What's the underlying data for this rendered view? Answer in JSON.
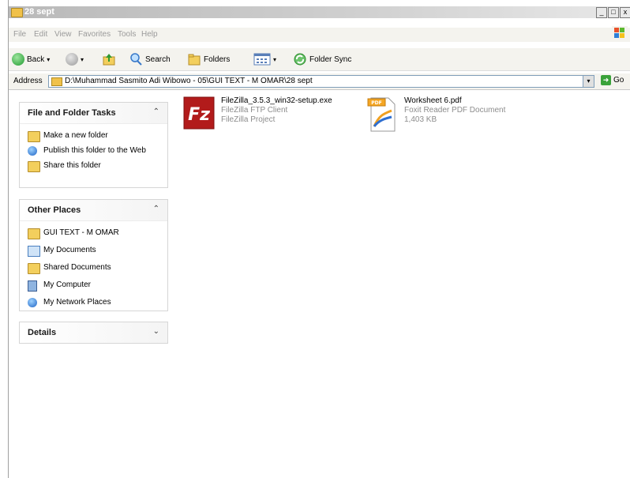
{
  "window": {
    "title": "28 sept",
    "buttons": {
      "minimize": "_",
      "maximize": "□",
      "close": "x"
    }
  },
  "menu": [
    "File",
    "Edit",
    "View",
    "Favorites",
    "Tools",
    "Help"
  ],
  "toolbar": {
    "back": "Back",
    "search": "Search",
    "folders": "Folders",
    "folder_sync": "Folder Sync"
  },
  "address": {
    "label": "Address",
    "path": "D:\\Muhammad Sasmito Adi Wibowo - 05\\GUI TEXT - M OMAR\\28 sept",
    "go": "Go"
  },
  "sidebar": {
    "tasks": {
      "title": "File and Folder Tasks",
      "items": [
        "Make a new folder",
        "Publish this folder to the Web",
        "Share this folder"
      ]
    },
    "other_places": {
      "title": "Other Places",
      "items": [
        "GUI TEXT - M OMAR",
        "My Documents",
        "Shared Documents",
        "My Computer",
        "My Network Places"
      ]
    },
    "details": {
      "title": "Details"
    }
  },
  "files": [
    {
      "name": "FileZilla_3.5.3_win32-setup.exe",
      "type": "FileZilla FTP Client",
      "company": "FileZilla Project",
      "icon": "filezilla-icon"
    },
    {
      "name": "Worksheet 6.pdf",
      "type": "Foxit Reader PDF Document",
      "size": "1,403 KB",
      "icon": "pdf-icon"
    }
  ]
}
